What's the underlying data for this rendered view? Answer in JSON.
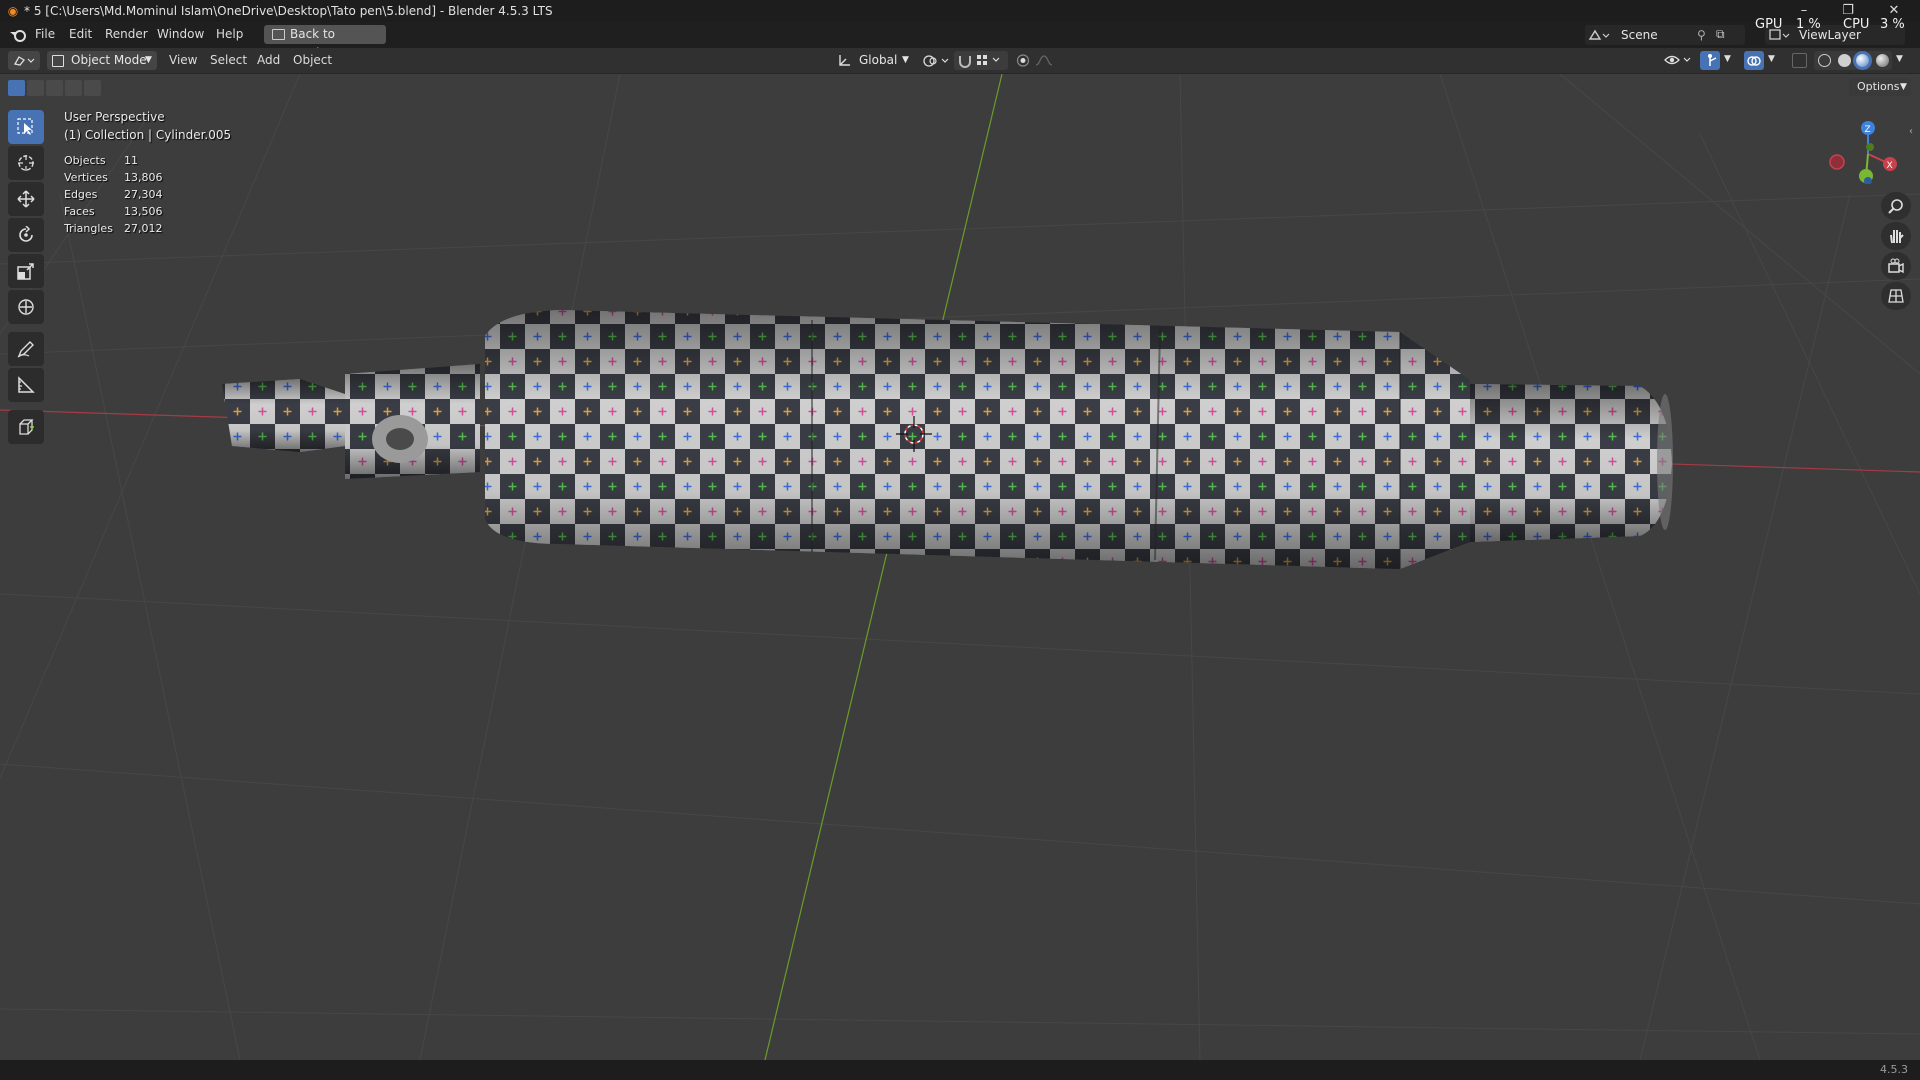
{
  "window": {
    "title": "* 5 [C:\\Users\\Md.Mominul Islam\\OneDrive\\Desktop\\Tato pen\\5.blend] - Blender 4.5.3 LTS",
    "app_icon": "blender-icon",
    "controls": [
      "minimize-icon",
      "maximize-icon",
      "close-icon"
    ]
  },
  "menubar": {
    "items": [
      "File",
      "Edit",
      "Render",
      "Window",
      "Help"
    ],
    "back_button": "Back to Previous",
    "scene": "Scene",
    "view_layer": "ViewLayer",
    "perf": {
      "gpu": "GPU",
      "gpu_value": "1 %",
      "cpu": "CPU",
      "cpu_value": "3 %"
    }
  },
  "header": {
    "mode": "Object Mode",
    "menus": [
      "View",
      "Select",
      "Add",
      "Object"
    ],
    "orientation": "Global",
    "options": "Options"
  },
  "viewport": {
    "perspective": "User Perspective",
    "context": "(1) Collection | Cylinder.005",
    "stats": [
      {
        "label": "Objects",
        "value": "11"
      },
      {
        "label": "Vertices",
        "value": "13,806"
      },
      {
        "label": "Edges",
        "value": "27,304"
      },
      {
        "label": "Faces",
        "value": "13,506"
      },
      {
        "label": "Triangles",
        "value": "27,012"
      }
    ],
    "gizmo": {
      "x": "X",
      "z": "Z"
    },
    "colors": {
      "x_axis": "#c9414d",
      "y_axis": "#79b833",
      "z_axis": "#3f82de",
      "background": "#3d3d3d"
    }
  },
  "tools": [
    "select-box-icon",
    "cursor-icon",
    "move-icon",
    "rotate-icon",
    "scale-icon",
    "transform-icon",
    "annotate-icon",
    "measure-icon",
    "add-cube-icon"
  ],
  "status": {
    "version": "4.5.3"
  }
}
